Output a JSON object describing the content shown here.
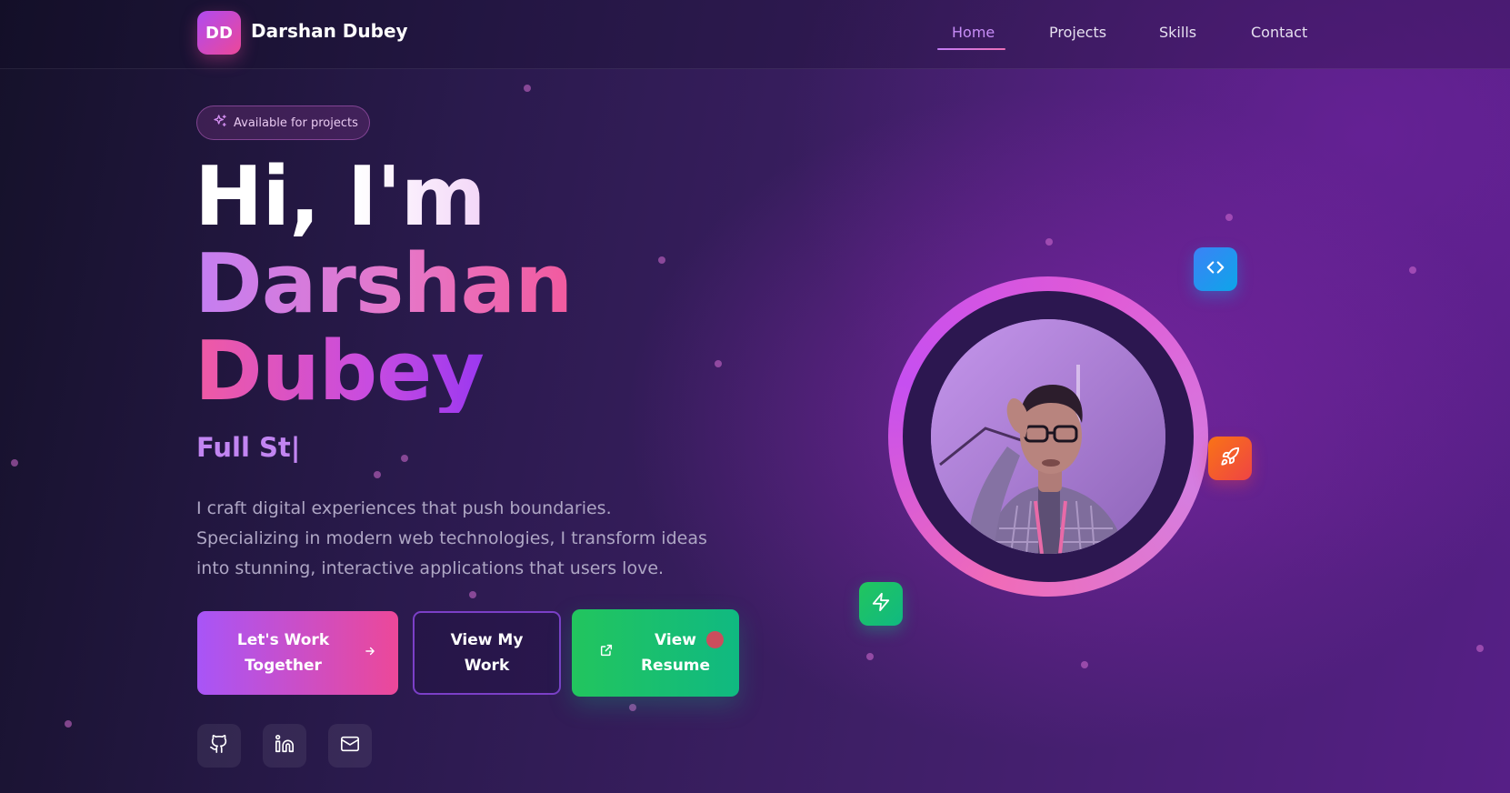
{
  "nav": {
    "logo_initials": "DD",
    "brand_name": "Darshan Dubey",
    "links": [
      {
        "label": "Home",
        "active": true
      },
      {
        "label": "Projects",
        "active": false
      },
      {
        "label": "Skills",
        "active": false
      },
      {
        "label": "Contact",
        "active": false
      }
    ]
  },
  "hero": {
    "badge": "Available for projects",
    "heading_line1": "Hi, I'm",
    "heading_line2": "Darshan",
    "heading_line3": "Dubey",
    "typed_text": "Full St|",
    "description": "I craft digital experiences that push boundaries. Specializing in modern web technologies, I transform ideas into stunning, interactive applications that users love.",
    "buttons": {
      "primary": "Let's Work Together",
      "secondary": "View My Work",
      "resume": "View Resume"
    },
    "socials": [
      {
        "icon": "github-icon"
      },
      {
        "icon": "linkedin-icon"
      },
      {
        "icon": "mail-icon"
      }
    ]
  },
  "portrait": {
    "floating_icons": [
      "code-icon",
      "rocket-icon",
      "lightning-icon"
    ]
  },
  "colors": {
    "accent_purple": "#a855f7",
    "accent_pink": "#ec4899",
    "resume_green": "#22c55e",
    "code_blue": "#3b82f6",
    "rocket_orange": "#f97316"
  }
}
